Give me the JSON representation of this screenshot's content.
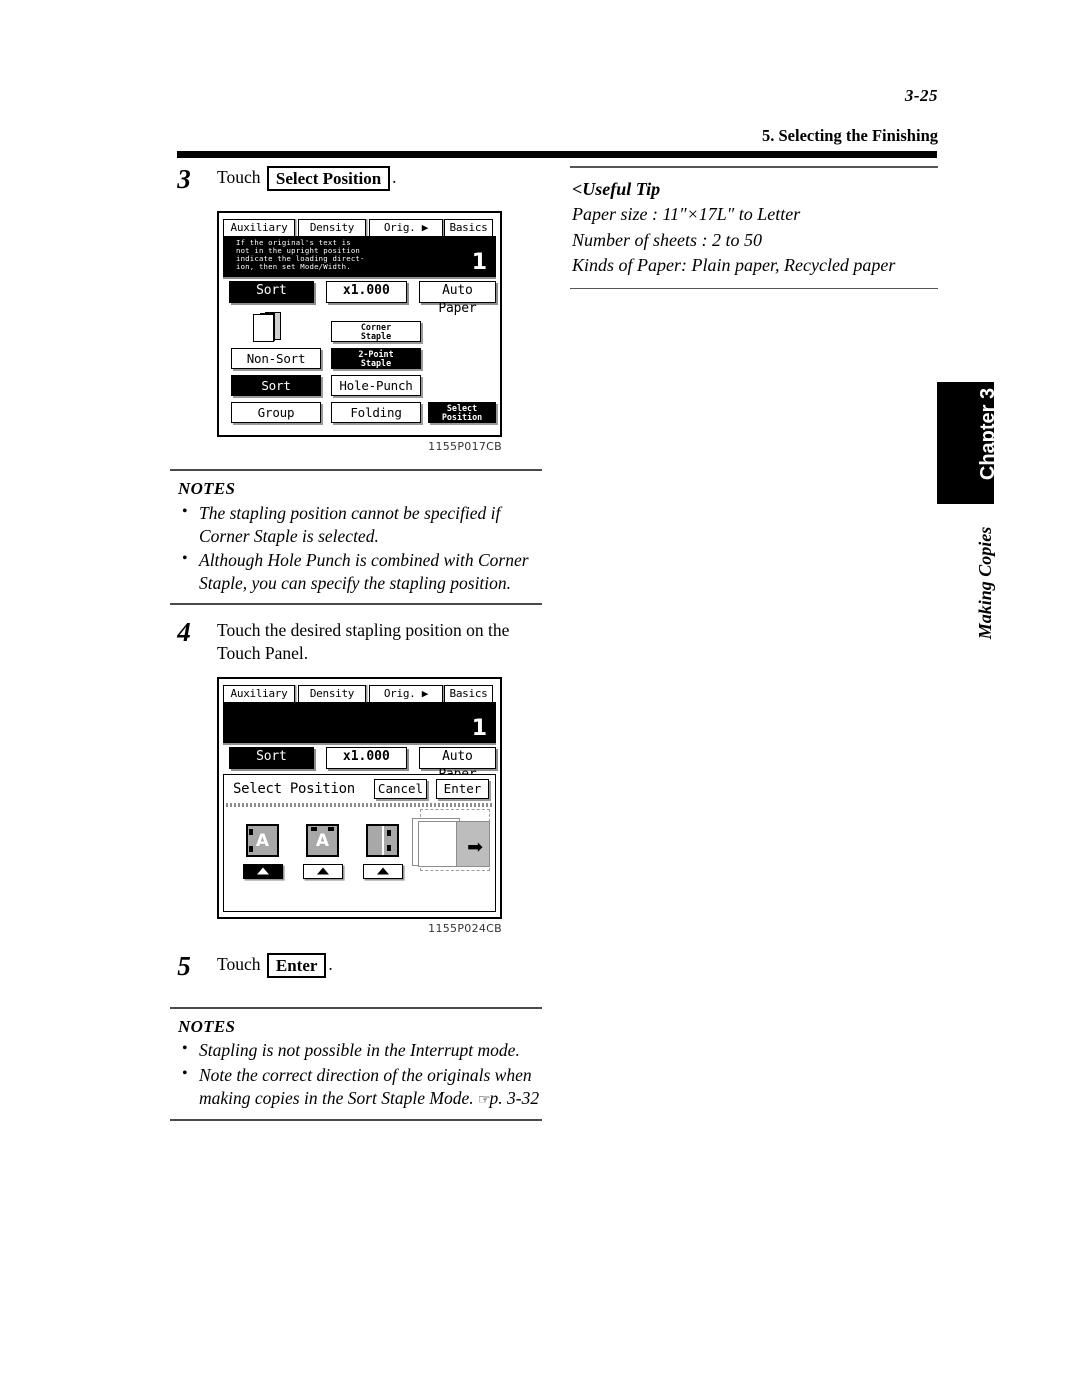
{
  "header": {
    "folio": "3-25",
    "running_head": "5. Selecting the Finishing"
  },
  "chapter_tab": {
    "label": "Chapter 3",
    "subtitle": "Making Copies"
  },
  "steps": {
    "step3": {
      "number": "3",
      "text_before": "Touch",
      "kbd": "Select Position",
      "text_after": "."
    },
    "step4": {
      "number": "4",
      "text": "Touch the desired stapling position on the Touch Panel."
    },
    "step5": {
      "number": "5",
      "text_before": "Touch",
      "kbd": "Enter",
      "text_after": "."
    }
  },
  "notes_1": {
    "title": "NOTES",
    "items": [
      "The stapling position cannot be specified if Corner Staple is selected.",
      "Although Hole Punch  is combined with Corner Staple, you can specify the stapling position."
    ]
  },
  "notes_2": {
    "title": "NOTES",
    "items": [
      "Stapling is not possible in the Interrupt mode.",
      "Note the correct direction of the originals when making copies in the Sort Staple Mode."
    ],
    "reference": "p. 3-32"
  },
  "useful_tip": {
    "title": "<Useful Tip",
    "lines": [
      "Paper size : 11″×17L″ to Letter",
      "Number of sheets : 2 to 50",
      "Kinds of Paper: Plain paper, Recycled paper"
    ]
  },
  "panel1": {
    "figure_number": "1155P017CB",
    "tabs": [
      "Auxiliary",
      "Density",
      "Orig. ▶ Copy",
      "Basics"
    ],
    "message": "If the original's text is\nnot in the upright position\nindicate the loading direct-\nion, then set Mode/Width.",
    "copy_count": "1",
    "status_buttons": [
      {
        "label": "Sort",
        "selected": true
      },
      {
        "label": "x1.000",
        "selected": false
      },
      {
        "label": "Auto Paper",
        "selected": false
      }
    ],
    "buttons": [
      {
        "label": "Non-Sort",
        "selected": false
      },
      {
        "label": "Sort",
        "selected": true
      },
      {
        "label": "Group",
        "selected": false
      },
      {
        "label": "Corner\nStaple",
        "selected": false
      },
      {
        "label": "2-Point\nStaple",
        "selected": true
      },
      {
        "label": "Hole-Punch",
        "selected": false
      },
      {
        "label": "Folding",
        "selected": false
      },
      {
        "label": "Select\nPosition",
        "selected": true
      }
    ]
  },
  "panel2": {
    "figure_number": "1155P024CB",
    "tabs": [
      "Auxiliary",
      "Density",
      "Orig. ▶ Copy",
      "Basics"
    ],
    "message": "",
    "copy_count": "1",
    "status_buttons": [
      {
        "label": "Sort",
        "selected": true
      },
      {
        "label": "x1.000",
        "selected": false
      },
      {
        "label": "Auto Paper",
        "selected": false
      }
    ],
    "dialog": {
      "title": "Select Position",
      "cancel_label": "Cancel",
      "enter_label": "Enter",
      "position_options": [
        {
          "name": "left-edge-two-staples",
          "letter": "A",
          "selected": true
        },
        {
          "name": "top-edge-two-staples",
          "letter": "A",
          "selected": false
        },
        {
          "name": "right-edge-two-staples",
          "letter": "",
          "selected": false
        }
      ],
      "preview_arrow": "➡"
    }
  }
}
